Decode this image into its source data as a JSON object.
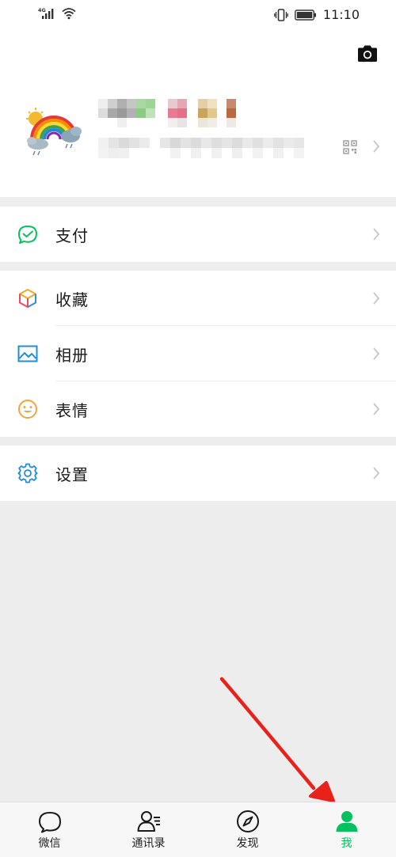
{
  "status_bar": {
    "network": "4G",
    "time": "11:10",
    "icons": [
      "signal-icon",
      "wifi-icon",
      "vibrate-icon",
      "battery-icon"
    ]
  },
  "profile": {
    "camera_icon": "camera-icon",
    "qr_icon": "qr-code-icon"
  },
  "menu": {
    "pay": {
      "label": "支付",
      "icon": "wallet-check-icon",
      "color": "#07c160"
    },
    "favorites": {
      "label": "收藏",
      "icon": "cube-icon"
    },
    "album": {
      "label": "相册",
      "icon": "picture-icon",
      "color": "#1f8ed6"
    },
    "stickers": {
      "label": "表情",
      "icon": "smiley-icon",
      "color": "#f3a43c"
    },
    "settings": {
      "label": "设置",
      "icon": "gear-icon",
      "color": "#1f8ed6"
    }
  },
  "tabbar": {
    "tabs": [
      {
        "label": "微信",
        "icon": "chat-bubble-icon"
      },
      {
        "label": "通讯录",
        "icon": "contacts-icon"
      },
      {
        "label": "发现",
        "icon": "compass-icon"
      },
      {
        "label": "我",
        "icon": "person-icon"
      }
    ],
    "active_index": 3,
    "active_color": "#07c160"
  },
  "annotation": {
    "color": "#e8221b"
  }
}
